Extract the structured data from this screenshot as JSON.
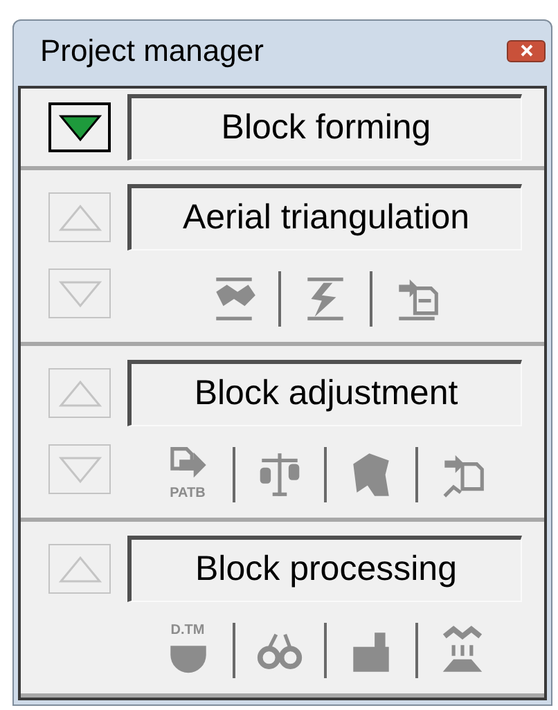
{
  "window": {
    "title": "Project manager"
  },
  "sections": [
    {
      "label": "Block forming",
      "arrows": [
        {
          "kind": "down",
          "active": true
        }
      ]
    },
    {
      "label": "Aerial triangulation",
      "arrows": [
        {
          "kind": "up",
          "active": false
        },
        {
          "kind": "down",
          "active": false
        }
      ],
      "tools": [
        {
          "disabled": true
        },
        {
          "disabled": true
        },
        {
          "disabled": true
        }
      ]
    },
    {
      "label": "Block adjustment",
      "arrows": [
        {
          "kind": "up",
          "active": false
        },
        {
          "kind": "down",
          "active": false
        }
      ],
      "tools": [
        {
          "disabled": true,
          "caption": "PATB"
        },
        {
          "disabled": true
        },
        {
          "disabled": true
        },
        {
          "disabled": true
        }
      ]
    },
    {
      "label": "Block processing",
      "arrows": [
        {
          "kind": "up",
          "active": false
        }
      ],
      "tools": [
        {
          "disabled": true,
          "caption": "D.TM"
        },
        {
          "disabled": true
        },
        {
          "disabled": true
        },
        {
          "disabled": true
        }
      ]
    }
  ]
}
